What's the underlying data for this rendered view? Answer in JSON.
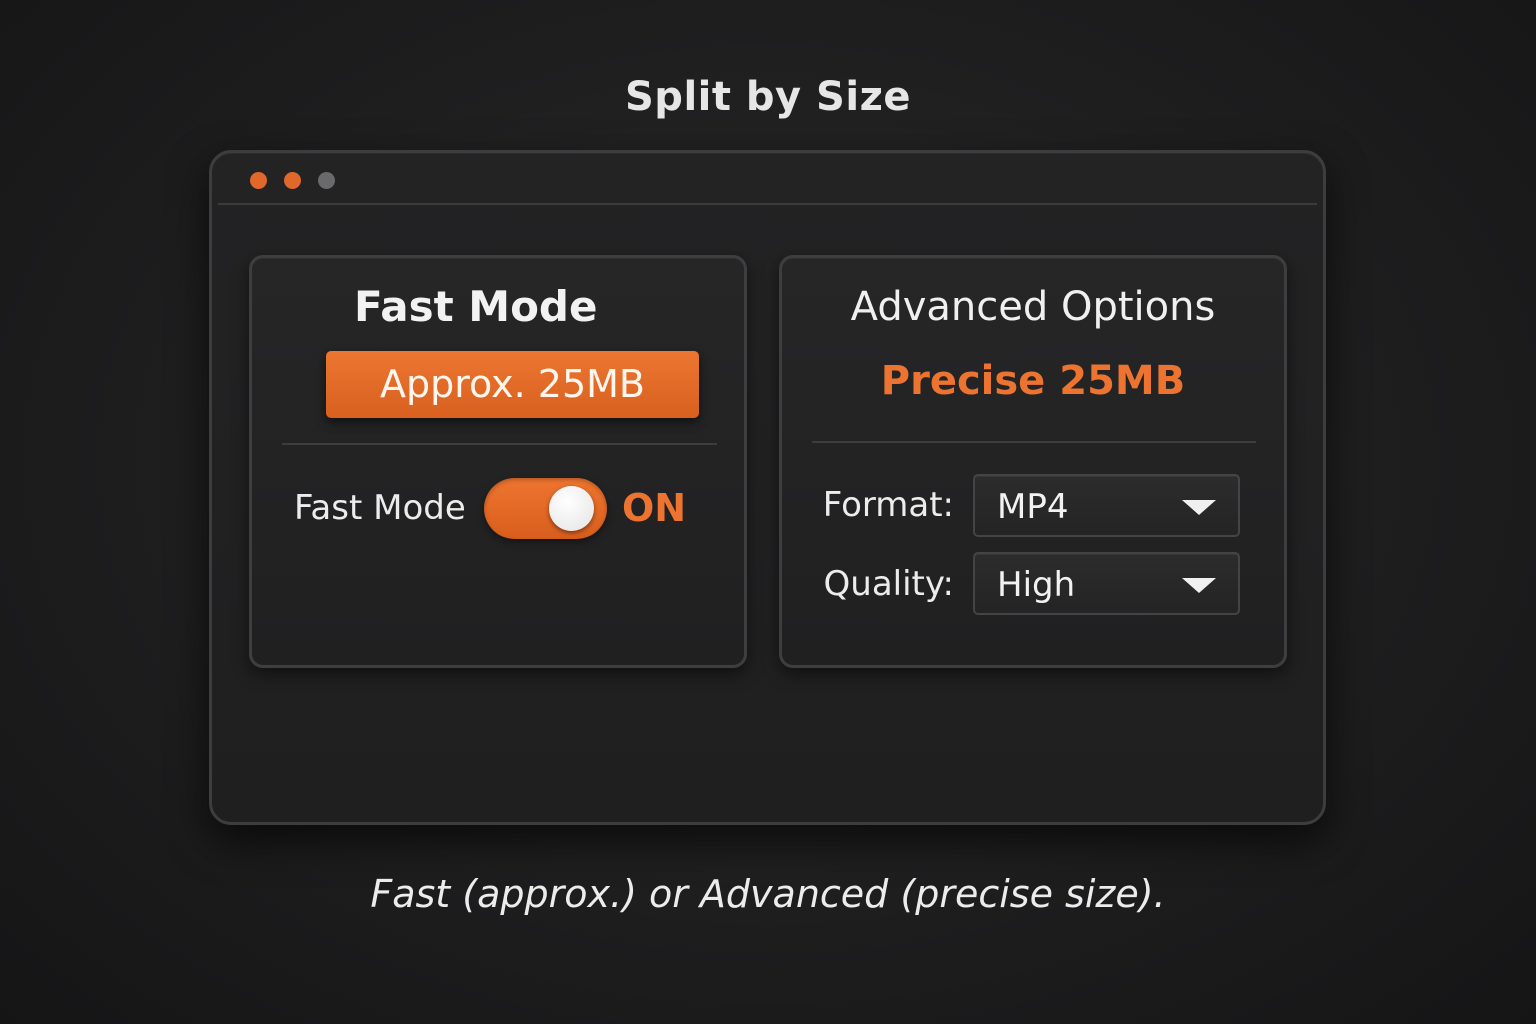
{
  "heading": "Split by Size",
  "window": {
    "controls": [
      "close",
      "minimize",
      "zoom"
    ]
  },
  "fast_panel": {
    "title": "Fast Mode",
    "badge": "Approx. 25MB",
    "toggle_label": "Fast Mode",
    "toggle_on": true,
    "toggle_state": "ON"
  },
  "advanced_panel": {
    "title": "Advanced Options",
    "subtitle": "Precise 25MB",
    "format": {
      "label": "Format:",
      "value": "MP4"
    },
    "quality": {
      "label": "Quality:",
      "value": "High"
    }
  },
  "caption": "Fast (approx.) or Advanced (precise size).",
  "colors": {
    "accent": "#ec7430",
    "background": "#1f1f20",
    "text": "#ececec"
  }
}
